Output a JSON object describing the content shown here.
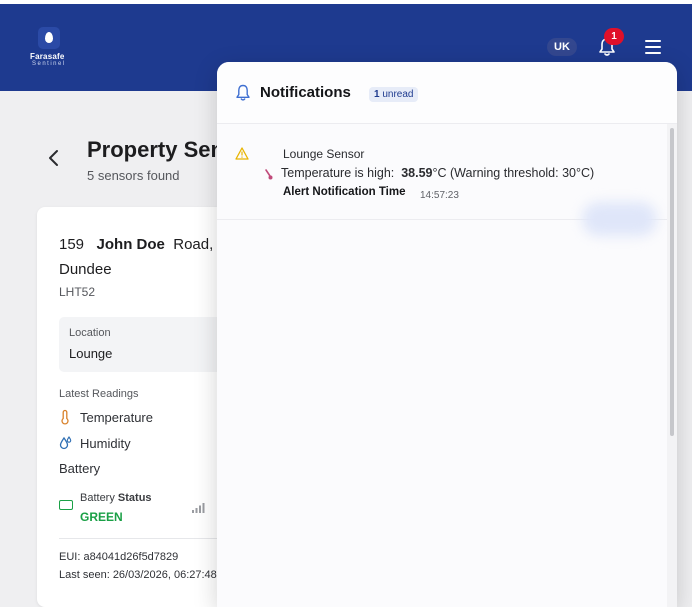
{
  "app": {
    "brand": "Farasafe",
    "brand_sub": "Sentinel"
  },
  "header": {
    "language": "UK",
    "notification_count": "1"
  },
  "page": {
    "title": "Property Sen",
    "subtitle": "5 sensors found"
  },
  "sensor_card": {
    "address_number": "159",
    "address_name": "John Doe",
    "address_rest": "Road,",
    "address_city": "Dundee",
    "model": "LHT52",
    "location_label": "Location",
    "location_value": "Lounge",
    "readings_label": "Latest Readings",
    "temperature_label": "Temperature",
    "humidity_label": "Humidity",
    "battery_label": "Battery",
    "battery_status_label_a": "Battery",
    "battery_status_label_b": "Status",
    "battery_status_value": "GREEN",
    "eui": "EUI: a84041d26f5d7829",
    "last_seen": "Last seen: 26/03/2026, 06:27:48"
  },
  "notifications_panel": {
    "title": "Notifications",
    "unread_count": "1",
    "unread_label": "unread",
    "items": [
      {
        "sensor": "Lounge Sensor",
        "message_prefix": "Temperature is high:",
        "message_value": "38.59",
        "message_suffix": "°C (Warning threshold: 30°C)",
        "time_label": "Alert Notification Time",
        "time_value": "14:57:23"
      }
    ]
  },
  "colors": {
    "header_bg": "#1e3a8f",
    "badge": "#e0102a",
    "status_green": "#1aa046",
    "warning": "#e8b400",
    "temperature_icon": "#d9822b",
    "humidity_icon": "#2f6fb3"
  }
}
